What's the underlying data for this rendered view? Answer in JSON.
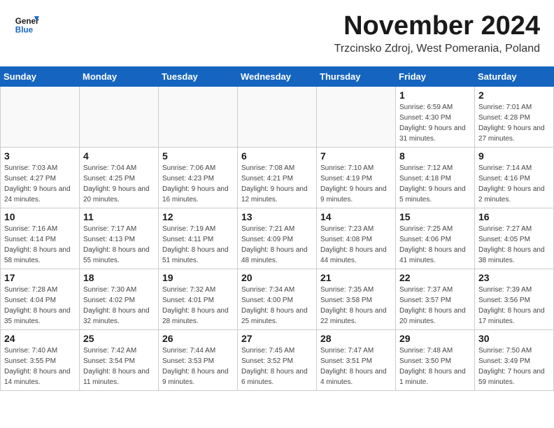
{
  "header": {
    "logo_line1": "General",
    "logo_line2": "Blue",
    "month": "November 2024",
    "location": "Trzcinsko Zdroj, West Pomerania, Poland"
  },
  "weekdays": [
    "Sunday",
    "Monday",
    "Tuesday",
    "Wednesday",
    "Thursday",
    "Friday",
    "Saturday"
  ],
  "weeks": [
    [
      {
        "day": "",
        "info": ""
      },
      {
        "day": "",
        "info": ""
      },
      {
        "day": "",
        "info": ""
      },
      {
        "day": "",
        "info": ""
      },
      {
        "day": "",
        "info": ""
      },
      {
        "day": "1",
        "info": "Sunrise: 6:59 AM\nSunset: 4:30 PM\nDaylight: 9 hours\nand 31 minutes."
      },
      {
        "day": "2",
        "info": "Sunrise: 7:01 AM\nSunset: 4:28 PM\nDaylight: 9 hours\nand 27 minutes."
      }
    ],
    [
      {
        "day": "3",
        "info": "Sunrise: 7:03 AM\nSunset: 4:27 PM\nDaylight: 9 hours\nand 24 minutes."
      },
      {
        "day": "4",
        "info": "Sunrise: 7:04 AM\nSunset: 4:25 PM\nDaylight: 9 hours\nand 20 minutes."
      },
      {
        "day": "5",
        "info": "Sunrise: 7:06 AM\nSunset: 4:23 PM\nDaylight: 9 hours\nand 16 minutes."
      },
      {
        "day": "6",
        "info": "Sunrise: 7:08 AM\nSunset: 4:21 PM\nDaylight: 9 hours\nand 12 minutes."
      },
      {
        "day": "7",
        "info": "Sunrise: 7:10 AM\nSunset: 4:19 PM\nDaylight: 9 hours\nand 9 minutes."
      },
      {
        "day": "8",
        "info": "Sunrise: 7:12 AM\nSunset: 4:18 PM\nDaylight: 9 hours\nand 5 minutes."
      },
      {
        "day": "9",
        "info": "Sunrise: 7:14 AM\nSunset: 4:16 PM\nDaylight: 9 hours\nand 2 minutes."
      }
    ],
    [
      {
        "day": "10",
        "info": "Sunrise: 7:16 AM\nSunset: 4:14 PM\nDaylight: 8 hours\nand 58 minutes."
      },
      {
        "day": "11",
        "info": "Sunrise: 7:17 AM\nSunset: 4:13 PM\nDaylight: 8 hours\nand 55 minutes."
      },
      {
        "day": "12",
        "info": "Sunrise: 7:19 AM\nSunset: 4:11 PM\nDaylight: 8 hours\nand 51 minutes."
      },
      {
        "day": "13",
        "info": "Sunrise: 7:21 AM\nSunset: 4:09 PM\nDaylight: 8 hours\nand 48 minutes."
      },
      {
        "day": "14",
        "info": "Sunrise: 7:23 AM\nSunset: 4:08 PM\nDaylight: 8 hours\nand 44 minutes."
      },
      {
        "day": "15",
        "info": "Sunrise: 7:25 AM\nSunset: 4:06 PM\nDaylight: 8 hours\nand 41 minutes."
      },
      {
        "day": "16",
        "info": "Sunrise: 7:27 AM\nSunset: 4:05 PM\nDaylight: 8 hours\nand 38 minutes."
      }
    ],
    [
      {
        "day": "17",
        "info": "Sunrise: 7:28 AM\nSunset: 4:04 PM\nDaylight: 8 hours\nand 35 minutes."
      },
      {
        "day": "18",
        "info": "Sunrise: 7:30 AM\nSunset: 4:02 PM\nDaylight: 8 hours\nand 32 minutes."
      },
      {
        "day": "19",
        "info": "Sunrise: 7:32 AM\nSunset: 4:01 PM\nDaylight: 8 hours\nand 28 minutes."
      },
      {
        "day": "20",
        "info": "Sunrise: 7:34 AM\nSunset: 4:00 PM\nDaylight: 8 hours\nand 25 minutes."
      },
      {
        "day": "21",
        "info": "Sunrise: 7:35 AM\nSunset: 3:58 PM\nDaylight: 8 hours\nand 22 minutes."
      },
      {
        "day": "22",
        "info": "Sunrise: 7:37 AM\nSunset: 3:57 PM\nDaylight: 8 hours\nand 20 minutes."
      },
      {
        "day": "23",
        "info": "Sunrise: 7:39 AM\nSunset: 3:56 PM\nDaylight: 8 hours\nand 17 minutes."
      }
    ],
    [
      {
        "day": "24",
        "info": "Sunrise: 7:40 AM\nSunset: 3:55 PM\nDaylight: 8 hours\nand 14 minutes."
      },
      {
        "day": "25",
        "info": "Sunrise: 7:42 AM\nSunset: 3:54 PM\nDaylight: 8 hours\nand 11 minutes."
      },
      {
        "day": "26",
        "info": "Sunrise: 7:44 AM\nSunset: 3:53 PM\nDaylight: 8 hours\nand 9 minutes."
      },
      {
        "day": "27",
        "info": "Sunrise: 7:45 AM\nSunset: 3:52 PM\nDaylight: 8 hours\nand 6 minutes."
      },
      {
        "day": "28",
        "info": "Sunrise: 7:47 AM\nSunset: 3:51 PM\nDaylight: 8 hours\nand 4 minutes."
      },
      {
        "day": "29",
        "info": "Sunrise: 7:48 AM\nSunset: 3:50 PM\nDaylight: 8 hours\nand 1 minute."
      },
      {
        "day": "30",
        "info": "Sunrise: 7:50 AM\nSunset: 3:49 PM\nDaylight: 7 hours\nand 59 minutes."
      }
    ]
  ]
}
